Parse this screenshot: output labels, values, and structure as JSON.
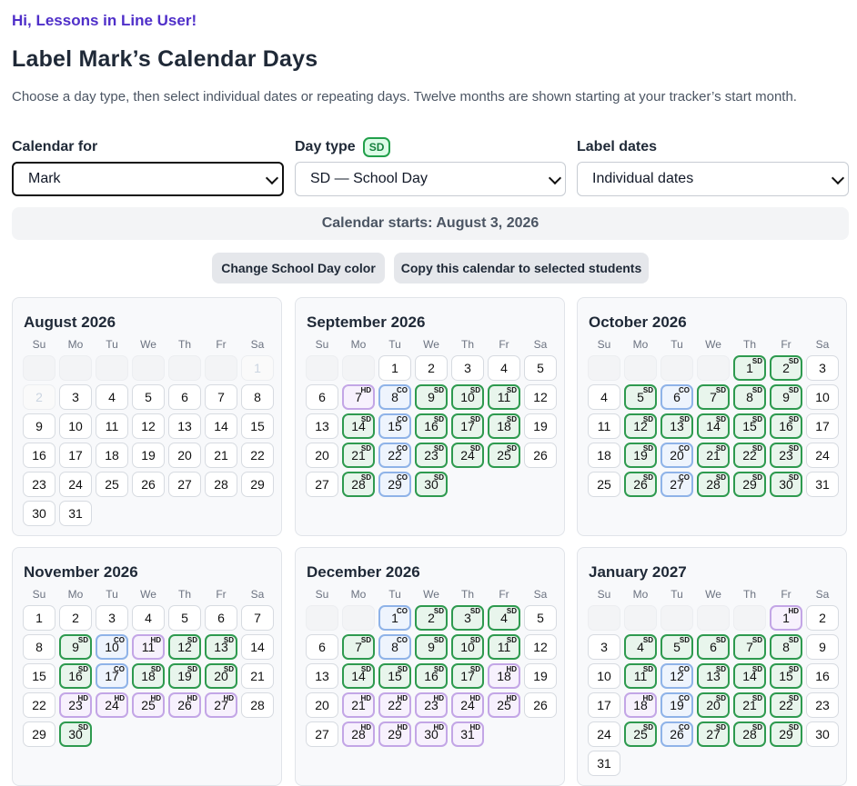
{
  "greeting": "Hi, Lessons in Line User!",
  "page_title": "Label Mark’s Calendar Days",
  "subtitle": "Choose a day type, then select individual dates or repeating days. Twelve months are shown starting at your tracker’s start month.",
  "fields": {
    "calendar_for": {
      "label": "Calendar for",
      "value": "Mark"
    },
    "day_type": {
      "label": "Day type",
      "badge": "SD",
      "value": "SD — School Day"
    },
    "label_dates": {
      "label": "Label dates",
      "value": "Individual dates"
    }
  },
  "calendar_start": "Calendar starts: August 3, 2026",
  "buttons": {
    "change_color": "Change School Day color",
    "copy_calendar": "Copy this calendar to selected students"
  },
  "weekdays": [
    "Su",
    "Mo",
    "Tu",
    "We",
    "Th",
    "Fr",
    "Sa"
  ],
  "colors": {
    "school_day": "#2e9a4f",
    "closed": "#8fb3e8",
    "holiday": "#c3a6e6",
    "greeting": "#4f2fc9"
  },
  "months": [
    {
      "title": "August 2026",
      "first_weekday": 6,
      "days": 31,
      "dimmed": [
        1,
        2
      ],
      "labels": {}
    },
    {
      "title": "September 2026",
      "first_weekday": 2,
      "days": 30,
      "dimmed": [],
      "labels": {
        "7": "HD",
        "8": "CO",
        "9": "SD",
        "10": "SD",
        "11": "SD",
        "14": "SD",
        "15": "CO",
        "16": "SD",
        "17": "SD",
        "18": "SD",
        "21": "SD",
        "22": "CO",
        "23": "SD",
        "24": "SD",
        "25": "SD",
        "28": "SD",
        "29": "CO",
        "30": "SD"
      }
    },
    {
      "title": "October 2026",
      "first_weekday": 4,
      "days": 31,
      "dimmed": [],
      "labels": {
        "1": "SD",
        "2": "SD",
        "5": "SD",
        "6": "CO",
        "7": "SD",
        "8": "SD",
        "9": "SD",
        "12": "SD",
        "13": "SD",
        "14": "SD",
        "15": "SD",
        "16": "SD",
        "19": "SD",
        "20": "CO",
        "21": "SD",
        "22": "SD",
        "23": "SD",
        "26": "SD",
        "27": "CO",
        "28": "SD",
        "29": "SD",
        "30": "SD"
      }
    },
    {
      "title": "November 2026",
      "first_weekday": 0,
      "days": 30,
      "dimmed": [],
      "labels": {
        "9": "SD",
        "10": "CO",
        "11": "HD",
        "12": "SD",
        "13": "SD",
        "16": "SD",
        "17": "CO",
        "18": "SD",
        "19": "SD",
        "20": "SD",
        "23": "HD",
        "24": "HD",
        "25": "HD",
        "26": "HD",
        "27": "HD",
        "30": "SD"
      }
    },
    {
      "title": "December 2026",
      "first_weekday": 2,
      "days": 31,
      "dimmed": [],
      "labels": {
        "1": "CO",
        "2": "SD",
        "3": "SD",
        "4": "SD",
        "7": "SD",
        "8": "CO",
        "9": "SD",
        "10": "SD",
        "11": "SD",
        "14": "SD",
        "15": "SD",
        "16": "SD",
        "17": "SD",
        "18": "HD",
        "21": "HD",
        "22": "HD",
        "23": "HD",
        "24": "HD",
        "25": "HD",
        "28": "HD",
        "29": "HD",
        "30": "HD",
        "31": "HD"
      }
    },
    {
      "title": "January 2027",
      "first_weekday": 5,
      "days": 31,
      "dimmed": [],
      "labels": {
        "1": "HD",
        "4": "SD",
        "5": "SD",
        "6": "SD",
        "7": "SD",
        "8": "SD",
        "11": "SD",
        "12": "CO",
        "13": "SD",
        "14": "SD",
        "15": "SD",
        "18": "HD",
        "19": "CO",
        "20": "SD",
        "21": "SD",
        "22": "SD",
        "25": "SD",
        "26": "CO",
        "27": "SD",
        "28": "SD",
        "29": "SD"
      }
    }
  ]
}
